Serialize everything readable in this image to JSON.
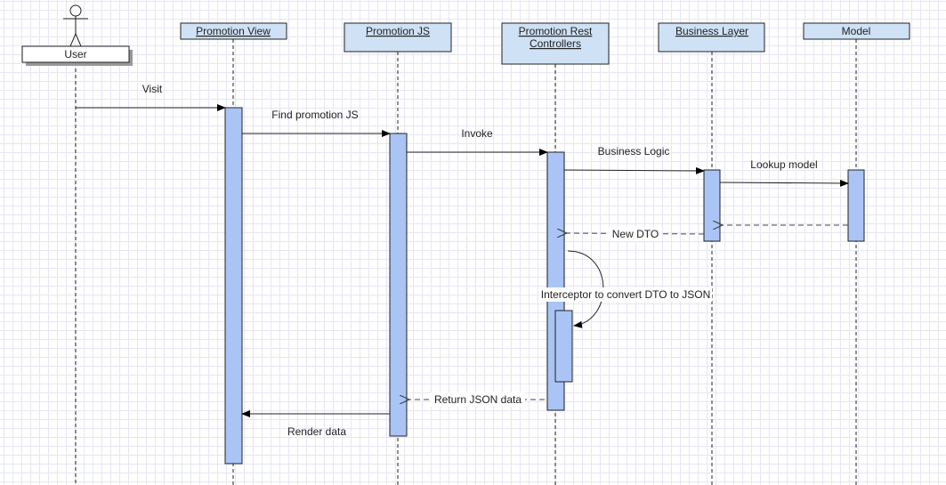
{
  "participants": [
    {
      "name": "User",
      "type": "actor"
    },
    {
      "name": "Promotion View",
      "underlined": true
    },
    {
      "name": "Promotion JS",
      "underlined": true
    },
    {
      "name_lines": [
        "Promotion Rest",
        "Controllers"
      ],
      "underlined": true
    },
    {
      "name": "Business Layer",
      "underlined": true
    },
    {
      "name": "Model",
      "underlined": false
    }
  ],
  "messages": [
    {
      "label": "Visit",
      "from": "User",
      "to": "Promotion View",
      "style": "solid"
    },
    {
      "label": "Find promotion JS",
      "from": "Promotion View",
      "to": "Promotion JS",
      "style": "solid"
    },
    {
      "label": "Invoke",
      "from": "Promotion JS",
      "to": "Promotion Rest Controllers",
      "style": "solid"
    },
    {
      "label": "Business Logic",
      "from": "Promotion Rest Controllers",
      "to": "Business Layer",
      "style": "solid"
    },
    {
      "label": "Lookup model",
      "from": "Business Layer",
      "to": "Model",
      "style": "solid"
    },
    {
      "label": "",
      "from": "Model",
      "to": "Business Layer",
      "style": "dashed"
    },
    {
      "label": "New DTO",
      "from": "Business Layer",
      "to": "Promotion Rest Controllers",
      "style": "dashed"
    },
    {
      "label": "Interceptor to convert DTO to JSON",
      "from": "Promotion Rest Controllers",
      "to": "Promotion Rest Controllers",
      "style": "self"
    },
    {
      "label": "Return JSON data",
      "from": "Promotion Rest Controllers",
      "to": "Promotion JS",
      "style": "dashed"
    },
    {
      "label": "Render data",
      "from": "Promotion JS",
      "to": "Promotion View",
      "style": "solid"
    }
  ],
  "colors": {
    "header": "#cfe1f5",
    "activation": "#a9c4f5",
    "grid": "#e6e6f5"
  }
}
